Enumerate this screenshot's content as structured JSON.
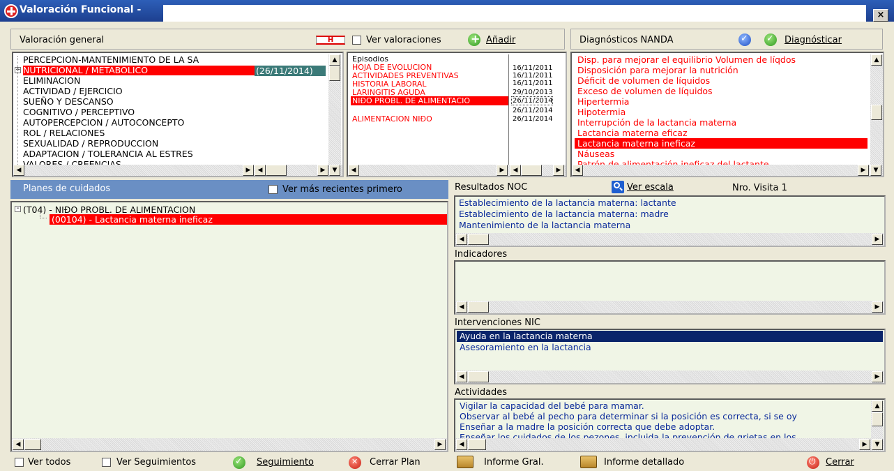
{
  "window": {
    "title": "Valoración Funcional -",
    "close_label": "×"
  },
  "valoracion": {
    "header": "Valoración general",
    "h_badge": "H",
    "ver_valoraciones": "Ver valoraciones",
    "anadir": "Añadir",
    "patterns": [
      "PERCEPCION-MANTENIMIENTO DE LA SA",
      "NUTRICIONAL / METABOLICO",
      "ELIMINACION",
      "ACTIVIDAD / EJERCICIO",
      "SUEÑO Y DESCANSO",
      "COGNITIVO / PERCEPTIVO",
      "AUTOPERCEPCION / AUTOCONCEPTO",
      "ROL / RELACIONES",
      "SEXUALIDAD / REPRODUCCION",
      "ADAPTACION / TOLERANCIA AL ESTRES",
      "VALORES / CREENCIAS"
    ],
    "selected_date": "(26/11/2014)"
  },
  "episodios": {
    "header": "Episodios",
    "items": [
      {
        "name": "HOJA DE EVOLUCION",
        "date": "16/11/2011"
      },
      {
        "name": "ACTIVIDADES PREVENTIVAS",
        "date": "16/11/2011"
      },
      {
        "name": "HISTORIA LABORAL",
        "date": "16/11/2011"
      },
      {
        "name": "LARINGITIS AGUDA",
        "date": "29/10/2013"
      },
      {
        "name": "NIÐO PROBL. DE ALIMENTACIO",
        "date": "26/11/2014"
      },
      {
        "name": "",
        "date": "26/11/2014"
      },
      {
        "name": "ALIMENTACION NIÐO",
        "date": "26/11/2014"
      }
    ]
  },
  "nanda": {
    "header": "Diagnósticos NANDA",
    "diagnosticar": "Diagnósticar",
    "items": [
      "Disp. para mejorar el equilibrio Volumen de líqdos",
      "Disposición para mejorar la nutrición",
      "Déficit de volumen de líquidos",
      "Exceso de volumen de líquidos",
      "Hipertermia",
      "Hipotermia",
      "Interrupción de la lactancia materna",
      "Lactancia materna eficaz",
      "Lactancia materna ineficaz",
      "Náuseas",
      "Patrón de alimentación ineficaz del lactante"
    ]
  },
  "planes": {
    "header": "Planes de cuidados",
    "ver_recientes": "Ver más recientes primero",
    "tree_root": "(T04) - NIÐO  PROBL. DE ALIMENTACION",
    "tree_child": "(00104) - Lactancia materna ineficaz"
  },
  "noc": {
    "header": "Resultados NOC",
    "ver_escala": "Ver escala",
    "nro_visita": "Nro. Visita 1",
    "items": [
      "Establecimiento de la lactancia materna: lactante",
      "Establecimiento de la lactancia materna: madre",
      "Mantenimiento de la lactancia materna"
    ]
  },
  "indicadores": {
    "header": "Indicadores"
  },
  "nic": {
    "header": "Intervenciones NIC",
    "items": [
      "Ayuda en la lactancia materna",
      "Asesoramiento en la lactancia"
    ]
  },
  "actividades": {
    "header": "Actividades",
    "items": [
      "Vigilar la capacidad del bebé para mamar.",
      "Observar al bebé al pecho para determinar si la posición es correcta, si se oy",
      "Enseñar a la madre la posición correcta que debe adoptar.",
      "Enseñar los cuidados de los pezones, incluida la prevención de grietas en los"
    ]
  },
  "bottom": {
    "ver_todos": "Ver todos",
    "ver_seguimientos": "Ver Seguimientos",
    "seguimiento": "Seguimiento",
    "cerrar_plan": "Cerrar Plan",
    "informe_gral": "Informe Gral.",
    "informe_detallado": "Informe detallado",
    "cerrar": "Cerrar"
  }
}
